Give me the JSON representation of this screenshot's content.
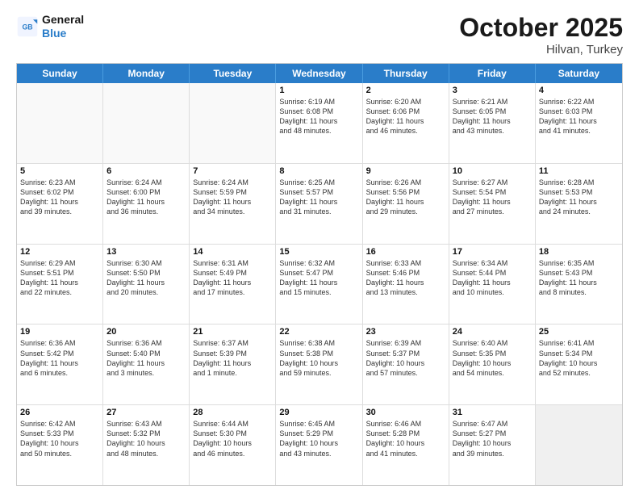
{
  "header": {
    "logo_line1": "General",
    "logo_line2": "Blue",
    "month": "October 2025",
    "location": "Hilvan, Turkey"
  },
  "weekdays": [
    "Sunday",
    "Monday",
    "Tuesday",
    "Wednesday",
    "Thursday",
    "Friday",
    "Saturday"
  ],
  "rows": [
    [
      {
        "day": "",
        "lines": [],
        "empty": true
      },
      {
        "day": "",
        "lines": [],
        "empty": true
      },
      {
        "day": "",
        "lines": [],
        "empty": true
      },
      {
        "day": "1",
        "lines": [
          "Sunrise: 6:19 AM",
          "Sunset: 6:08 PM",
          "Daylight: 11 hours",
          "and 48 minutes."
        ]
      },
      {
        "day": "2",
        "lines": [
          "Sunrise: 6:20 AM",
          "Sunset: 6:06 PM",
          "Daylight: 11 hours",
          "and 46 minutes."
        ]
      },
      {
        "day": "3",
        "lines": [
          "Sunrise: 6:21 AM",
          "Sunset: 6:05 PM",
          "Daylight: 11 hours",
          "and 43 minutes."
        ]
      },
      {
        "day": "4",
        "lines": [
          "Sunrise: 6:22 AM",
          "Sunset: 6:03 PM",
          "Daylight: 11 hours",
          "and 41 minutes."
        ]
      }
    ],
    [
      {
        "day": "5",
        "lines": [
          "Sunrise: 6:23 AM",
          "Sunset: 6:02 PM",
          "Daylight: 11 hours",
          "and 39 minutes."
        ]
      },
      {
        "day": "6",
        "lines": [
          "Sunrise: 6:24 AM",
          "Sunset: 6:00 PM",
          "Daylight: 11 hours",
          "and 36 minutes."
        ]
      },
      {
        "day": "7",
        "lines": [
          "Sunrise: 6:24 AM",
          "Sunset: 5:59 PM",
          "Daylight: 11 hours",
          "and 34 minutes."
        ]
      },
      {
        "day": "8",
        "lines": [
          "Sunrise: 6:25 AM",
          "Sunset: 5:57 PM",
          "Daylight: 11 hours",
          "and 31 minutes."
        ]
      },
      {
        "day": "9",
        "lines": [
          "Sunrise: 6:26 AM",
          "Sunset: 5:56 PM",
          "Daylight: 11 hours",
          "and 29 minutes."
        ]
      },
      {
        "day": "10",
        "lines": [
          "Sunrise: 6:27 AM",
          "Sunset: 5:54 PM",
          "Daylight: 11 hours",
          "and 27 minutes."
        ]
      },
      {
        "day": "11",
        "lines": [
          "Sunrise: 6:28 AM",
          "Sunset: 5:53 PM",
          "Daylight: 11 hours",
          "and 24 minutes."
        ]
      }
    ],
    [
      {
        "day": "12",
        "lines": [
          "Sunrise: 6:29 AM",
          "Sunset: 5:51 PM",
          "Daylight: 11 hours",
          "and 22 minutes."
        ]
      },
      {
        "day": "13",
        "lines": [
          "Sunrise: 6:30 AM",
          "Sunset: 5:50 PM",
          "Daylight: 11 hours",
          "and 20 minutes."
        ]
      },
      {
        "day": "14",
        "lines": [
          "Sunrise: 6:31 AM",
          "Sunset: 5:49 PM",
          "Daylight: 11 hours",
          "and 17 minutes."
        ]
      },
      {
        "day": "15",
        "lines": [
          "Sunrise: 6:32 AM",
          "Sunset: 5:47 PM",
          "Daylight: 11 hours",
          "and 15 minutes."
        ]
      },
      {
        "day": "16",
        "lines": [
          "Sunrise: 6:33 AM",
          "Sunset: 5:46 PM",
          "Daylight: 11 hours",
          "and 13 minutes."
        ]
      },
      {
        "day": "17",
        "lines": [
          "Sunrise: 6:34 AM",
          "Sunset: 5:44 PM",
          "Daylight: 11 hours",
          "and 10 minutes."
        ]
      },
      {
        "day": "18",
        "lines": [
          "Sunrise: 6:35 AM",
          "Sunset: 5:43 PM",
          "Daylight: 11 hours",
          "and 8 minutes."
        ]
      }
    ],
    [
      {
        "day": "19",
        "lines": [
          "Sunrise: 6:36 AM",
          "Sunset: 5:42 PM",
          "Daylight: 11 hours",
          "and 6 minutes."
        ]
      },
      {
        "day": "20",
        "lines": [
          "Sunrise: 6:36 AM",
          "Sunset: 5:40 PM",
          "Daylight: 11 hours",
          "and 3 minutes."
        ]
      },
      {
        "day": "21",
        "lines": [
          "Sunrise: 6:37 AM",
          "Sunset: 5:39 PM",
          "Daylight: 11 hours",
          "and 1 minute."
        ]
      },
      {
        "day": "22",
        "lines": [
          "Sunrise: 6:38 AM",
          "Sunset: 5:38 PM",
          "Daylight: 10 hours",
          "and 59 minutes."
        ]
      },
      {
        "day": "23",
        "lines": [
          "Sunrise: 6:39 AM",
          "Sunset: 5:37 PM",
          "Daylight: 10 hours",
          "and 57 minutes."
        ]
      },
      {
        "day": "24",
        "lines": [
          "Sunrise: 6:40 AM",
          "Sunset: 5:35 PM",
          "Daylight: 10 hours",
          "and 54 minutes."
        ]
      },
      {
        "day": "25",
        "lines": [
          "Sunrise: 6:41 AM",
          "Sunset: 5:34 PM",
          "Daylight: 10 hours",
          "and 52 minutes."
        ]
      }
    ],
    [
      {
        "day": "26",
        "lines": [
          "Sunrise: 6:42 AM",
          "Sunset: 5:33 PM",
          "Daylight: 10 hours",
          "and 50 minutes."
        ]
      },
      {
        "day": "27",
        "lines": [
          "Sunrise: 6:43 AM",
          "Sunset: 5:32 PM",
          "Daylight: 10 hours",
          "and 48 minutes."
        ]
      },
      {
        "day": "28",
        "lines": [
          "Sunrise: 6:44 AM",
          "Sunset: 5:30 PM",
          "Daylight: 10 hours",
          "and 46 minutes."
        ]
      },
      {
        "day": "29",
        "lines": [
          "Sunrise: 6:45 AM",
          "Sunset: 5:29 PM",
          "Daylight: 10 hours",
          "and 43 minutes."
        ]
      },
      {
        "day": "30",
        "lines": [
          "Sunrise: 6:46 AM",
          "Sunset: 5:28 PM",
          "Daylight: 10 hours",
          "and 41 minutes."
        ]
      },
      {
        "day": "31",
        "lines": [
          "Sunrise: 6:47 AM",
          "Sunset: 5:27 PM",
          "Daylight: 10 hours",
          "and 39 minutes."
        ]
      },
      {
        "day": "",
        "lines": [],
        "empty": true,
        "shaded": true
      }
    ]
  ]
}
